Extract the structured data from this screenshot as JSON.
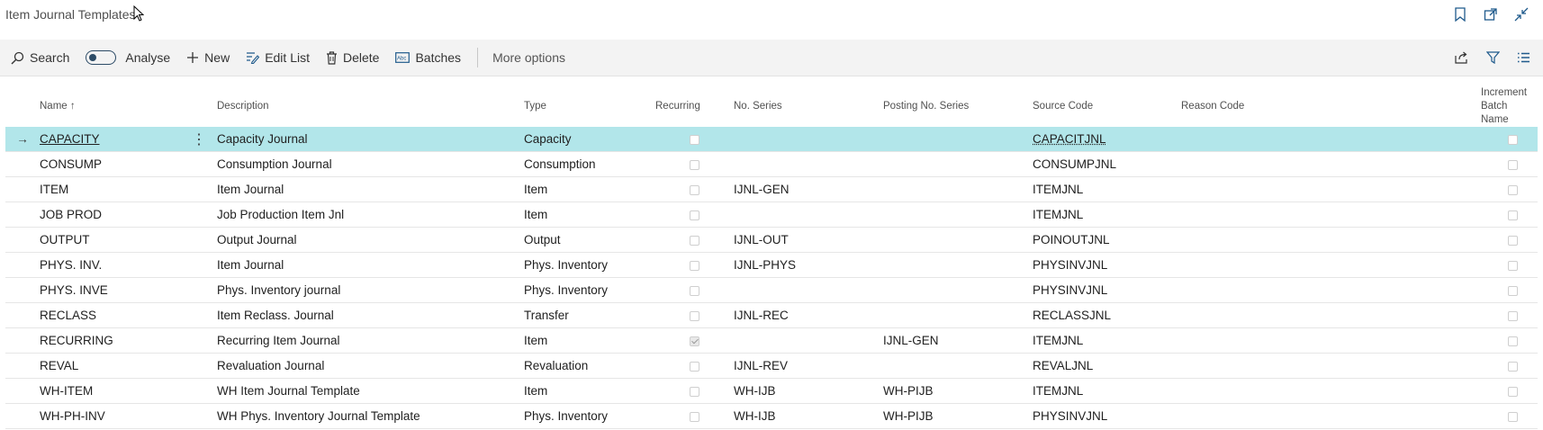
{
  "header": {
    "title": "Item Journal Templates"
  },
  "title_icons": [
    "bookmark-icon",
    "open-new-window-icon",
    "collapse-icon"
  ],
  "actions": {
    "search": "Search",
    "analyse": "Analyse",
    "new": "New",
    "edit_list": "Edit List",
    "delete": "Delete",
    "batches": "Batches",
    "more": "More options"
  },
  "right_actions": [
    "share-icon",
    "filter-icon",
    "list-view-icon"
  ],
  "columns": {
    "name": "Name ↑",
    "description": "Description",
    "type": "Type",
    "recurring": "Recurring",
    "no_series": "No. Series",
    "posting_no_series": "Posting No. Series",
    "source_code": "Source Code",
    "reason_code": "Reason Code",
    "increment_batch_name_1": "Increment",
    "increment_batch_name_2": "Batch Name"
  },
  "rows": [
    {
      "name": "CAPACITY",
      "description": "Capacity Journal",
      "type": "Capacity",
      "recurring": false,
      "no_series": "",
      "posting_no_series": "",
      "source_code": "CAPACITJNL",
      "reason_code": "",
      "increment": false,
      "selected": true
    },
    {
      "name": "CONSUMP",
      "description": "Consumption Journal",
      "type": "Consumption",
      "recurring": false,
      "no_series": "",
      "posting_no_series": "",
      "source_code": "CONSUMPJNL",
      "reason_code": "",
      "increment": false
    },
    {
      "name": "ITEM",
      "description": "Item Journal",
      "type": "Item",
      "recurring": false,
      "no_series": "IJNL-GEN",
      "posting_no_series": "",
      "source_code": "ITEMJNL",
      "reason_code": "",
      "increment": false
    },
    {
      "name": "JOB PROD",
      "description": "Job Production Item Jnl",
      "type": "Item",
      "recurring": false,
      "no_series": "",
      "posting_no_series": "",
      "source_code": "ITEMJNL",
      "reason_code": "",
      "increment": false
    },
    {
      "name": "OUTPUT",
      "description": "Output Journal",
      "type": "Output",
      "recurring": false,
      "no_series": "IJNL-OUT",
      "posting_no_series": "",
      "source_code": "POINOUTJNL",
      "reason_code": "",
      "increment": false
    },
    {
      "name": "PHYS. INV.",
      "description": "Item Journal",
      "type": "Phys. Inventory",
      "recurring": false,
      "no_series": "IJNL-PHYS",
      "posting_no_series": "",
      "source_code": "PHYSINVJNL",
      "reason_code": "",
      "increment": false
    },
    {
      "name": "PHYS. INVE",
      "description": "Phys. Inventory journal",
      "type": "Phys. Inventory",
      "recurring": false,
      "no_series": "",
      "posting_no_series": "",
      "source_code": "PHYSINVJNL",
      "reason_code": "",
      "increment": false
    },
    {
      "name": "RECLASS",
      "description": "Item Reclass. Journal",
      "type": "Transfer",
      "recurring": false,
      "no_series": "IJNL-REC",
      "posting_no_series": "",
      "source_code": "RECLASSJNL",
      "reason_code": "",
      "increment": false
    },
    {
      "name": "RECURRING",
      "description": "Recurring Item Journal",
      "type": "Item",
      "recurring": true,
      "no_series": "",
      "posting_no_series": "IJNL-GEN",
      "source_code": "ITEMJNL",
      "reason_code": "",
      "increment": false
    },
    {
      "name": "REVAL",
      "description": "Revaluation Journal",
      "type": "Revaluation",
      "recurring": false,
      "no_series": "IJNL-REV",
      "posting_no_series": "",
      "source_code": "REVALJNL",
      "reason_code": "",
      "increment": false
    },
    {
      "name": "WH-ITEM",
      "description": "WH Item Journal Template",
      "type": "Item",
      "recurring": false,
      "no_series": "WH-IJB",
      "posting_no_series": "WH-PIJB",
      "source_code": "ITEMJNL",
      "reason_code": "",
      "increment": false
    },
    {
      "name": "WH-PH-INV",
      "description": "WH Phys. Inventory Journal Template",
      "type": "Phys. Inventory",
      "recurring": false,
      "no_series": "WH-IJB",
      "posting_no_series": "WH-PIJB",
      "source_code": "PHYSINVJNL",
      "reason_code": "",
      "increment": false
    }
  ],
  "colors": {
    "selected_row": "#b2e6ea",
    "accent": "#2c4b66"
  }
}
